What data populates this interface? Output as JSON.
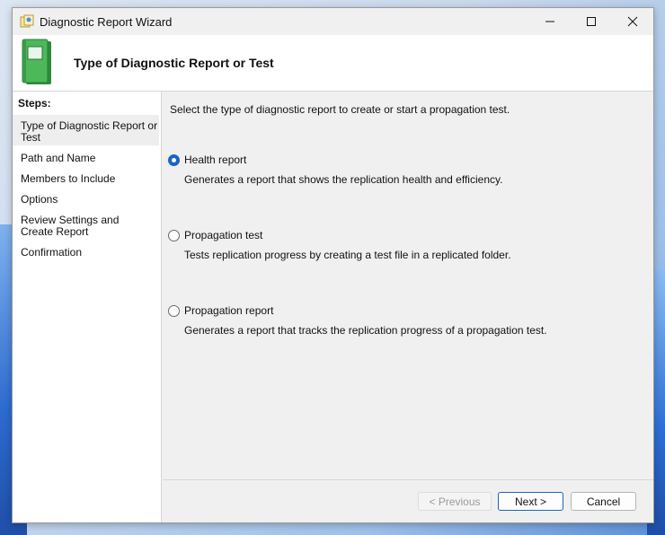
{
  "window": {
    "title": "Diagnostic Report Wizard"
  },
  "header": {
    "title": "Type of Diagnostic Report or Test"
  },
  "sidebar": {
    "heading": "Steps:",
    "items": [
      {
        "label": "Type of Diagnostic Report or Test",
        "active": true
      },
      {
        "label": "Path and Name"
      },
      {
        "label": "Members to Include"
      },
      {
        "label": "Options"
      },
      {
        "label": "Review Settings and Create Report"
      },
      {
        "label": "Confirmation"
      }
    ]
  },
  "main": {
    "intro": "Select the type of diagnostic report to create or start a propagation test.",
    "options": [
      {
        "label": "Health report",
        "description": "Generates a report that shows the replication health and efficiency.",
        "selected": true
      },
      {
        "label": "Propagation test",
        "description": "Tests replication progress by creating a test file in a replicated folder.",
        "selected": false
      },
      {
        "label": "Propagation report",
        "description": "Generates a report that tracks the replication progress of a propagation test.",
        "selected": false
      }
    ]
  },
  "buttons": {
    "previous": "< Previous",
    "next": "Next >",
    "cancel": "Cancel"
  },
  "colors": {
    "accent": "#1a65c0",
    "book_icon": "#3fa34d"
  }
}
